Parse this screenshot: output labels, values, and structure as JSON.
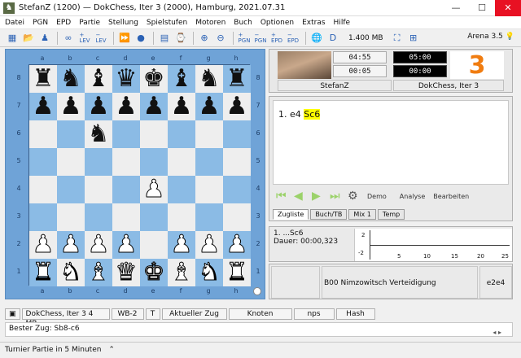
{
  "window": {
    "title": "StefanZ (1200)  —  DokChess, Iter 3 (2000),  Hamburg,  2021.07.31",
    "app_icon": "knight-icon"
  },
  "menu": [
    "Datei",
    "PGN",
    "EPD",
    "Partie",
    "Stellung",
    "Spielstufen",
    "Motoren",
    "Buch",
    "Optionen",
    "Extras",
    "Hilfe"
  ],
  "toolbar": {
    "memory": "1.400 MB",
    "arena_label": "Arena 3.5"
  },
  "board": {
    "files": [
      "a",
      "b",
      "c",
      "d",
      "e",
      "f",
      "g",
      "h"
    ],
    "ranks": [
      "8",
      "7",
      "6",
      "5",
      "4",
      "3",
      "2",
      "1"
    ],
    "colors": {
      "light": "#eeeeee",
      "dark": "#8bbbe5",
      "frame": "#6fa3d7"
    },
    "position": [
      [
        "br",
        "bn",
        "bb",
        "bq",
        "bk",
        "bb",
        "bn",
        "br"
      ],
      [
        "bp",
        "bp",
        "bp",
        "bp",
        "bp",
        "bp",
        "bp",
        "bp"
      ],
      [
        "",
        "",
        "bn",
        "",
        "",
        "",
        "",
        ""
      ],
      [
        "",
        "",
        "",
        "",
        "",
        "",
        "",
        ""
      ],
      [
        "",
        "",
        "",
        "",
        "wp",
        "",
        "",
        ""
      ],
      [
        "",
        "",
        "",
        "",
        "",
        "",
        "",
        ""
      ],
      [
        "wp",
        "wp",
        "wp",
        "wp",
        "",
        "wp",
        "wp",
        "wp"
      ],
      [
        "wr",
        "wn",
        "wb",
        "wq",
        "wk",
        "wb",
        "wn",
        "wr"
      ]
    ]
  },
  "players": {
    "white_name": "StefanZ",
    "white_clock_1": "04:55",
    "white_clock_2": "00:05",
    "black_name": "DokChess, Iter 3",
    "black_clock_1": "05:00",
    "black_clock_2": "00:00",
    "engine_logo": "3"
  },
  "notation": {
    "move_number": "1.",
    "white_move": "e4",
    "black_move": "Sc6",
    "demo_label": "Demo",
    "analyse_label": "Analyse",
    "bearbeiten_label": "Bearbeiten",
    "tabs": [
      "Zugliste",
      "Buch/TB",
      "Mix 1",
      "Temp"
    ]
  },
  "analysis": {
    "line": "1. ...Sc6",
    "duration": "Dauer: 00:00,323",
    "graph": {
      "y_labels": [
        "2",
        "-2"
      ],
      "x_labels": [
        "5",
        "10",
        "15",
        "20",
        "25"
      ]
    }
  },
  "opening": {
    "eco": "B00  Nimzowitsch Verteidigung",
    "move": "e2e4"
  },
  "status": {
    "engine": "DokChess, Iter 3",
    "hash_size": "4 MB",
    "wb": "WB-2",
    "t": "T",
    "current_move": "Aktueller Zug",
    "knoten": "Knoten",
    "nps": "nps",
    "hash": "Hash",
    "best_move": "Bester Zug: Sb8-c6",
    "tournament": "Turnier Partie in 5 Minuten"
  }
}
